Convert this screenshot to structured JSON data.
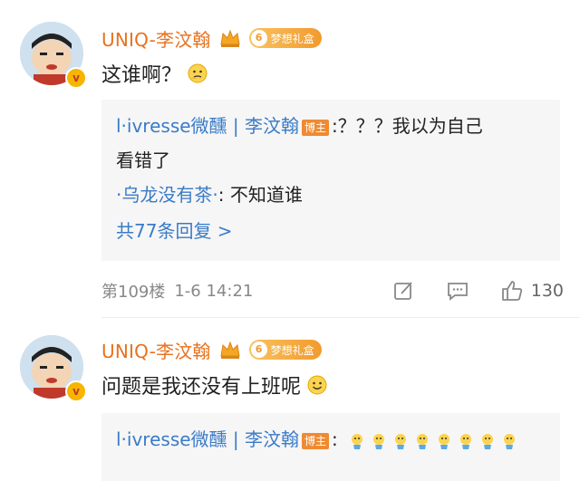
{
  "comments": [
    {
      "username": "UNIQ-李汶翰",
      "badge_level": "6",
      "badge_text": "梦想礼盒",
      "text": "这谁啊？",
      "replies": {
        "line1_user": "l·ivresse微醺",
        "line1_sep": "|",
        "line1_target": "李汶翰",
        "bozhu": "博主",
        "line1_text": ":？？？我以为自己",
        "line1_cont": "看错了",
        "line2_user": "·乌龙没有茶·",
        "line2_text": ": 不知道谁",
        "more": "共77条回复 >"
      },
      "meta": {
        "floor": "第109楼",
        "time": "1-6 14:21",
        "likes": "130"
      }
    },
    {
      "username": "UNIQ-李汶翰",
      "badge_level": "6",
      "badge_text": "梦想礼盒",
      "text": "问题是我还没有上班呢",
      "replies": {
        "line1_user": "l·ivresse微醺",
        "line1_sep": "|",
        "line1_target": "李汶翰",
        "bozhu": "博主",
        "line1_text": ":"
      }
    }
  ],
  "icons": {
    "crown": "crown-icon",
    "verified": "verified-v-icon",
    "edit": "repost-icon",
    "comment": "comment-icon",
    "like": "thumbs-up-icon",
    "thinking": "thinking-face-emoji",
    "smile": "smile-emoji",
    "crying": "crying-emoji"
  },
  "colors": {
    "username": "#e8711d",
    "link": "#3a7bc8",
    "bozhu": "#f08a30",
    "reply_bg": "#f6f6f6"
  }
}
